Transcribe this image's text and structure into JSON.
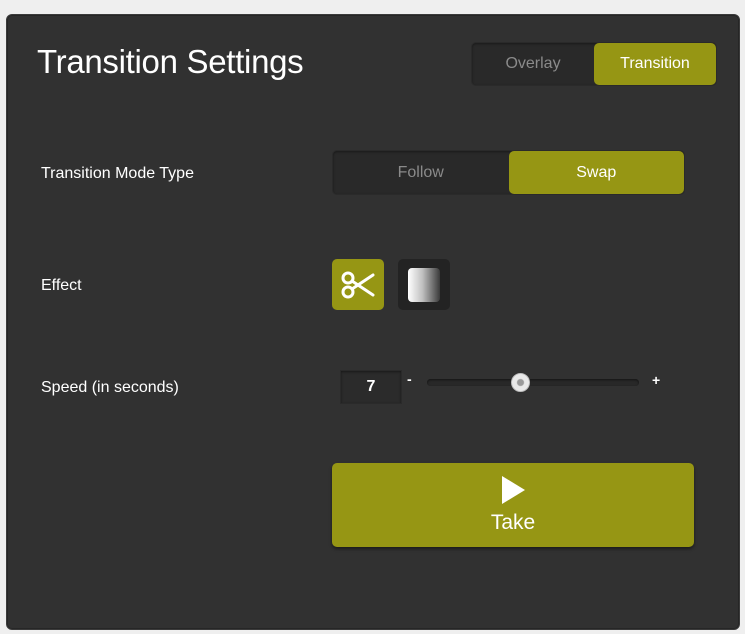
{
  "header": {
    "title": "Transition Settings"
  },
  "tabs": [
    {
      "label": "Overlay",
      "active": false
    },
    {
      "label": "Transition",
      "active": true
    }
  ],
  "mode": {
    "label": "Transition Mode Type",
    "options": [
      {
        "label": "Follow",
        "active": false
      },
      {
        "label": "Swap",
        "active": true
      }
    ]
  },
  "effect": {
    "label": "Effect",
    "options": [
      {
        "icon": "scissors-icon",
        "name": "cut",
        "active": true
      },
      {
        "icon": "fade-gradient-icon",
        "name": "fade",
        "active": false
      }
    ]
  },
  "speed": {
    "label": "Speed (in seconds)",
    "value": "7",
    "decrement_label": "-",
    "increment_label": "+",
    "slider_fraction": 0.44
  },
  "take": {
    "label": "Take",
    "icon": "play-icon"
  },
  "colors": {
    "accent": "#969614",
    "panel": "#313131",
    "inactive_segment": "#292929"
  }
}
